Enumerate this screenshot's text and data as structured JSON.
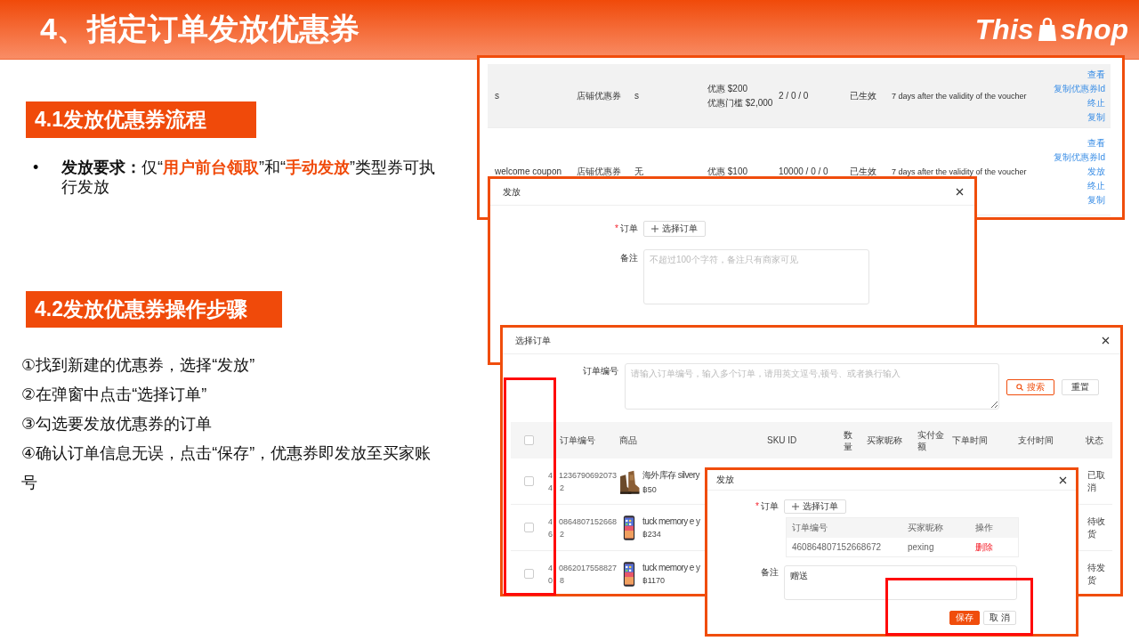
{
  "header": {
    "title": "4、指定订单发放优惠券",
    "logo": {
      "word_1": "This",
      "word_2": "shop"
    }
  },
  "section_1": {
    "heading": "4.1发放优惠券流程",
    "bullets": [
      {
        "marker": "•",
        "segments": [
          {
            "text": "发放要求：",
            "kind": "bold"
          },
          {
            "text": "仅“",
            "kind": "plain"
          },
          {
            "text": "用户前台领取",
            "kind": "accent"
          },
          {
            "text": "”和“",
            "kind": "plain"
          },
          {
            "text": "手动发放",
            "kind": "accent"
          },
          {
            "text": "”类型券可执行发放",
            "kind": "plain"
          }
        ]
      }
    ]
  },
  "section_2": {
    "heading": "4.2发放优惠券操作步骤",
    "steps": [
      "①找到新建的优惠券，选择“发放”",
      "②在弹窗中点击“选择订单”",
      "③勾选要发放优惠券的订单",
      "④确认订单信息无误，点击“保存”，优惠券即发放至买家账号"
    ]
  },
  "coupon_list": {
    "rows": [
      {
        "hovered": true,
        "column_1": "s",
        "column_2": "店铺优惠券",
        "column_3": "s",
        "discount": [
          "优惠 $200",
          "优惠门槛 $2,000"
        ],
        "counts": "2 / 0 / 0",
        "status": "已生效",
        "validity": "7 days after the validity of the voucher",
        "actions": [
          "查看",
          "复制优惠券Id",
          "终止",
          "复制"
        ]
      },
      {
        "hovered": false,
        "column_1": "welcome coupon",
        "column_2": "店铺优惠券",
        "column_3": "无",
        "discount": [
          "优惠 $100"
        ],
        "counts": "10000 / 0 / 0",
        "status": "已生效",
        "validity": "7 days after the validity of the voucher",
        "actions": [
          "查看",
          "复制优惠券Id",
          "发放",
          "终止",
          "复制"
        ]
      }
    ]
  },
  "issue_dialog": {
    "title": "发放",
    "order_field": {
      "required_mark": "*",
      "label": "订单",
      "button": "选择订单"
    },
    "note_field": {
      "label": "备注",
      "placeholder": "不超过100个字符，备注只有商家可见"
    }
  },
  "select_order_dialog": {
    "title": "选择订单",
    "search": {
      "label": "订单编号",
      "placeholder": "请输入订单编号，输入多个订单，请用英文逗号,顿号、或者换行输入"
    },
    "buttons": [
      {
        "label": "搜索",
        "kind": "outline"
      },
      {
        "label": "重置",
        "kind": "default"
      }
    ],
    "table": {
      "select_all_checked": false,
      "columns": [
        "订单编号",
        "商品",
        "SKU ID",
        "数量",
        "买家昵称",
        "实付金额",
        "下单时间",
        "支付时间",
        "状态"
      ],
      "rows": [
        {
          "checked": false,
          "order_no": [
            [
              "4",
              "1236790692073"
            ],
            [
              "4",
              "2"
            ]
          ],
          "product": "海外库存 silvery",
          "price": "฿50",
          "status": "已取消"
        },
        {
          "checked": false,
          "order_no": [
            [
              "4",
              "0864807152668"
            ],
            [
              "6",
              "2"
            ]
          ],
          "product": "tuck memory e y",
          "price": "฿234",
          "status": "待收货"
        },
        {
          "checked": false,
          "order_no": [
            [
              "4",
              "0862017558827"
            ],
            [
              "0",
              "8"
            ]
          ],
          "product": "tuck memory e y",
          "price": "฿1170",
          "status": "待发货"
        }
      ]
    }
  },
  "issue_dialog_filled": {
    "title": "发放",
    "order_field": {
      "required_mark": "*",
      "label": "订单",
      "button": "选择订单"
    },
    "selected_orders": {
      "columns": [
        "订单编号",
        "买家昵称",
        "操作"
      ],
      "rows": [
        {
          "order_no": "460864807152668672",
          "buyer": "pexing",
          "action": "删除"
        }
      ]
    },
    "note_field": {
      "label": "备注",
      "value": "赠送"
    },
    "buttons": [
      {
        "label": "保存",
        "kind": "filled"
      },
      {
        "label": "取 消",
        "kind": "default"
      }
    ]
  }
}
